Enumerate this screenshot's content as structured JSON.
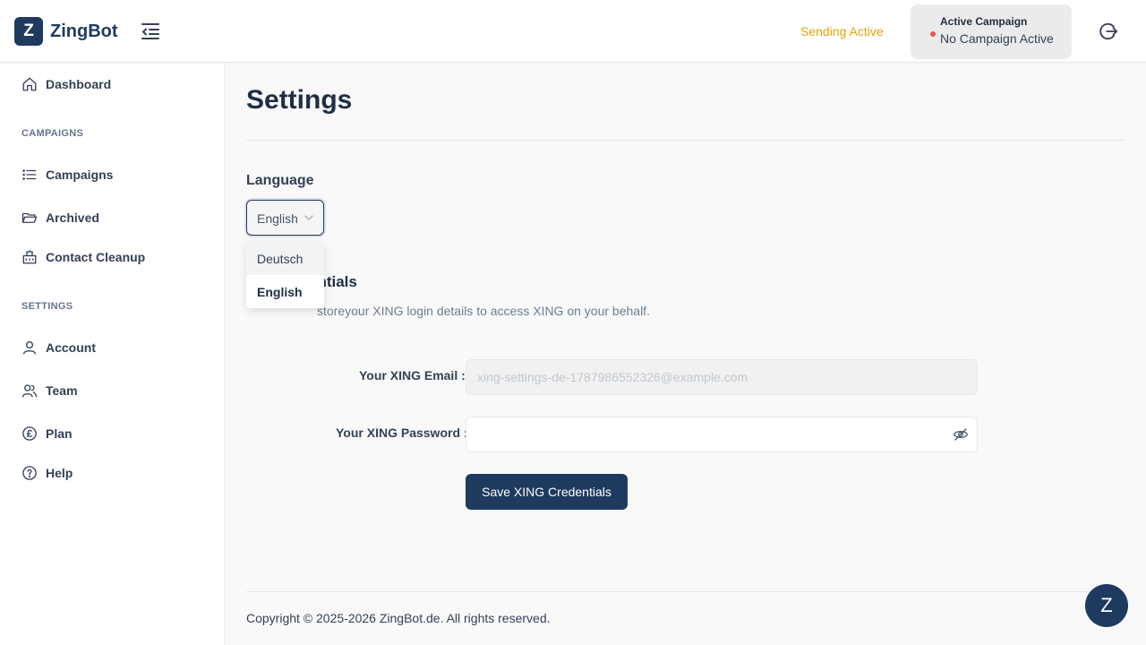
{
  "header": {
    "logo_letter": "Z",
    "brand": "ZingBot",
    "sending_status": "Sending Active",
    "active_campaign_title": "Active Campaign",
    "active_campaign_value": "No Campaign Active",
    "colors": {
      "brand": "#1e3a5f",
      "sending": "#e3a300",
      "status_dot": "#ef5350"
    }
  },
  "sidebar": {
    "dashboard": "Dashboard",
    "section_campaigns": "CAMPAIGNS",
    "campaigns": "Campaigns",
    "archived": "Archived",
    "contact_cleanup": "Contact Cleanup",
    "section_settings": "SETTINGS",
    "account": "Account",
    "team": "Team",
    "plan": "Plan",
    "help": "Help",
    "icons": [
      "home-icon",
      "list-icon",
      "folder-open-icon",
      "building-icon",
      "user-icon",
      "users-icon",
      "pound-icon",
      "help-circle-icon"
    ]
  },
  "main": {
    "title": "Settings",
    "language_label": "Language",
    "language_selected": "English",
    "language_options": [
      "Deutsch",
      "English"
    ],
    "credentials_title_visible": "entials",
    "credentials_desc_visible": "storeyour XING login details to access XING on your behalf.",
    "email_label": "Your XING Email :",
    "email_placeholder": "xing-settings-de-1787986552326@example.com",
    "password_label": "Your XING Password :",
    "password_value": "",
    "save_button": "Save XING Credentials"
  },
  "footer": {
    "copyright": "Copyright © 2025-2026 ZingBot.de. All rights reserved.",
    "chat_letter": "Z"
  }
}
